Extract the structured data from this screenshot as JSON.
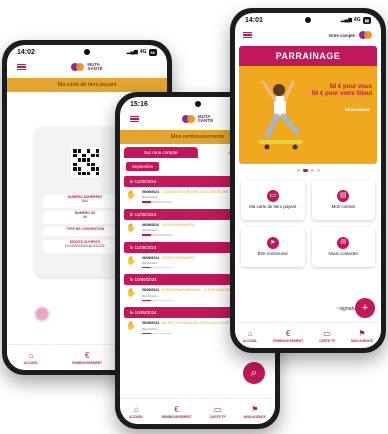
{
  "phone1": {
    "time": "14:02",
    "signal": "4G",
    "battery": "66",
    "logo": {
      "line1": "MUTA",
      "line2": "SANTÉ"
    },
    "title": "Ma carte de tiers payant",
    "card_fields": [
      {
        "label": "NUMÉRO ADHÉRENT",
        "value": "864"
      },
      {
        "label": "NUMÉRO SS",
        "value": "68"
      },
      {
        "label": "TYPE DE CONVENTION",
        "value": ""
      },
      {
        "label": "DROITS OUVERTS",
        "value": "Du 01/01/2024 au 31/12/2"
      }
    ],
    "nav": [
      "ACCUEIL",
      "REMBOURSEMENT",
      "CARTE T"
    ]
  },
  "phone2": {
    "time": "15:16",
    "logo": {
      "line1": "MUTA",
      "line2": "SANTÉ"
    },
    "title": "Mes remboursements",
    "tabs": [
      "Sur mon compte",
      "Aux p"
    ],
    "month": "Septembre",
    "entries": [
      {
        "date_header": "le 11/09/2024",
        "date": "06/09/2024",
        "act": "CONSULTATION SPÉCIALIS MÉDECINE GÉNÉRALE",
        "beneficiary": "Bénéficiaire :",
        "amount": "",
        "progress": 0.3
      },
      {
        "date_header": "le 11/09/2024",
        "date": "06/09/2024",
        "act": "SOINS INFIRMIERS",
        "beneficiary": "Bénéficiaire :",
        "amount": "",
        "progress": 0.3
      },
      {
        "date_header": "le 11/09/2024",
        "date": "06/09/2024",
        "act": "SOINS INFIRMIERS",
        "beneficiary": "Bénéficiaire :",
        "amount": "",
        "progress": 0.3
      },
      {
        "date_header": "le 10/09/2024",
        "date": "06/09/2024",
        "act": "EURODEMLÉMATIQUE - A TECHNIQUES MÉDICALES",
        "beneficiary": "Bénéficiaire :",
        "amount": "",
        "progress": 0.3
      },
      {
        "date_header": "le 10/09/2024",
        "date": "05/09/2024",
        "act": "ACTES TECHNIQUES MÉDICAUX HCAS",
        "beneficiary": "Bénéficiaire :",
        "amount": "96,00 €",
        "progress": 0.3
      }
    ],
    "nav": [
      "ACCUEIL",
      "REMBOURSEMENT",
      "CARTE TP",
      "MON AGENCE"
    ]
  },
  "phone3": {
    "time": "14:01",
    "signal": "4G",
    "account_label": "Votre compte",
    "promo": {
      "title": "PARRAINAGE",
      "line1": "50 € pour vous",
      "line2": "50 € pour votre filleul",
      "code_hint": "RÉGLEMENT"
    },
    "tiles": [
      "Ma carte de tiers payant",
      "Mon contrat",
      "Être remboursé",
      "Nous contacter"
    ],
    "nav": [
      "ACCUEIL",
      "REMBOURSEMENT",
      "CARTE TP",
      "MON AGENCE"
    ]
  },
  "colors": {
    "accent": "#c0185a",
    "gold": "#e3a52d",
    "promo_bg": "#f0a81f"
  }
}
